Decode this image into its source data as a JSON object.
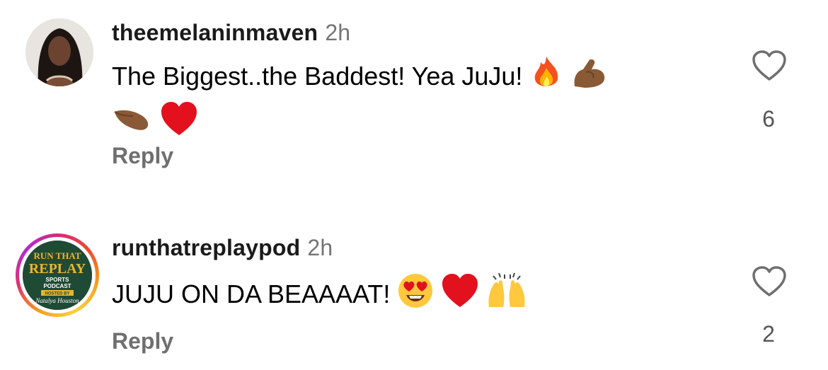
{
  "comments": [
    {
      "username": "theemelaninmaven",
      "time": "2h",
      "text": "The Biggest..the Baddest! Yea JuJu!",
      "emojis": [
        "fire",
        "flexed-biceps",
        "pinching-hand",
        "red-heart"
      ],
      "reply_label": "Reply",
      "likes": "6"
    },
    {
      "username": "runthatreplaypod",
      "time": "2h",
      "text": "JUJU ON DA BEAAAAT!",
      "emojis": [
        "heart-eyes",
        "red-heart",
        "raising-hands"
      ],
      "reply_label": "Reply",
      "likes": "2",
      "avatar_logo": {
        "line1": "RUN THAT",
        "line2": "REPLAY",
        "line3": "SPORTS",
        "line4": "PODCAST",
        "line5": "HOSTED BY",
        "line6": "Natalya Houston"
      }
    }
  ],
  "colors": {
    "username": "#1b1b1b",
    "meta": "#757575",
    "heart_emoji": "#e3101e",
    "logo_bg": "#1f4a35",
    "logo_gold": "#e9b530"
  }
}
